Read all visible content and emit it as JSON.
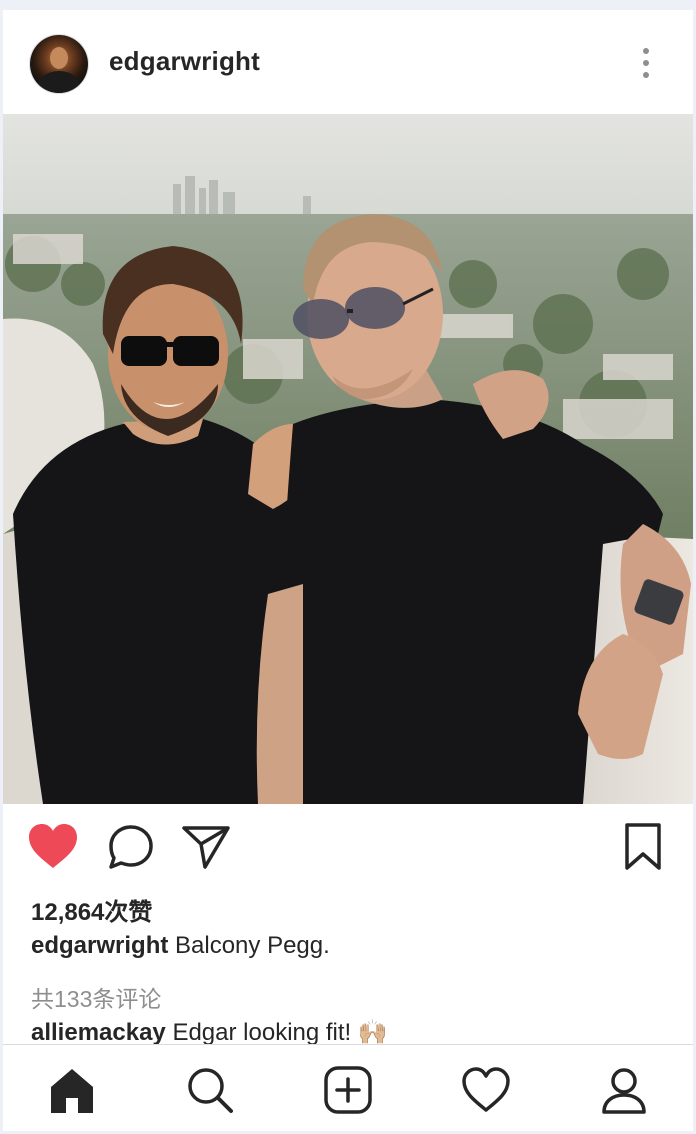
{
  "post": {
    "username": "edgarwright",
    "likes_text": "12,864次赞",
    "caption_user": "edgarwright",
    "caption_text": "Balcony Pegg.",
    "view_comments_text": "共133条评论",
    "comment": {
      "user": "alliemackay",
      "text": "Edgar looking fit! 🙌🏼"
    },
    "liked": true
  },
  "icons": {
    "more": "more-vertical-icon",
    "like": "heart-filled-icon",
    "comment": "comment-bubble-icon",
    "share": "paper-plane-icon",
    "save": "bookmark-icon"
  },
  "bottom_nav": [
    "home-icon",
    "search-icon",
    "add-post-icon",
    "activity-heart-icon",
    "profile-icon"
  ],
  "colors": {
    "like_red": "#ed4956",
    "text": "#262626",
    "muted": "#8e8e8e"
  }
}
